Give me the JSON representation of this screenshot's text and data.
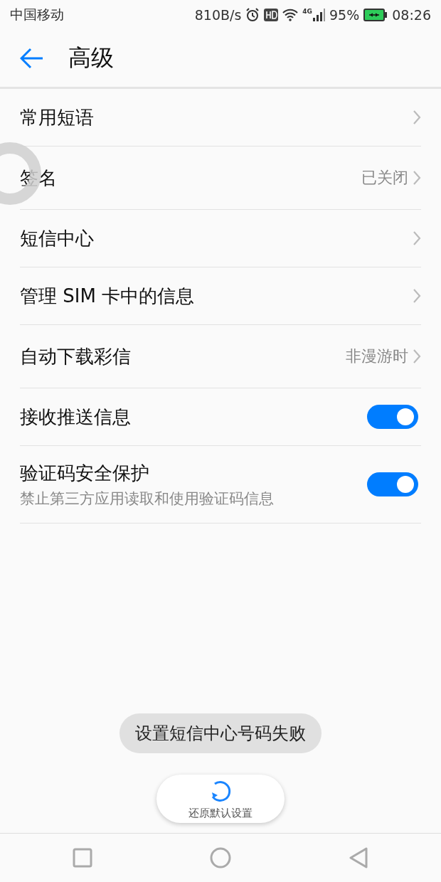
{
  "status_bar": {
    "carrier": "中国移动",
    "speed": "810B/s",
    "network": "4G",
    "battery": "95%",
    "time": "08:26"
  },
  "header": {
    "title": "高级"
  },
  "items": [
    {
      "kind": "link",
      "title": "常用短语"
    },
    {
      "kind": "link",
      "title": "签名",
      "value": "已关闭"
    },
    {
      "kind": "link",
      "title": "短信中心"
    },
    {
      "kind": "link",
      "title": "管理 SIM 卡中的信息"
    },
    {
      "kind": "link",
      "title": "自动下载彩信",
      "value": "非漫游时"
    },
    {
      "kind": "toggle",
      "title": "接收推送信息",
      "on": true
    },
    {
      "kind": "toggle",
      "title": "验证码安全保护",
      "subtitle": "禁止第三方应用读取和使用验证码信息",
      "on": true
    }
  ],
  "toast": "设置短信中心号码失败",
  "restore_button": {
    "label": "还原默认设置"
  }
}
